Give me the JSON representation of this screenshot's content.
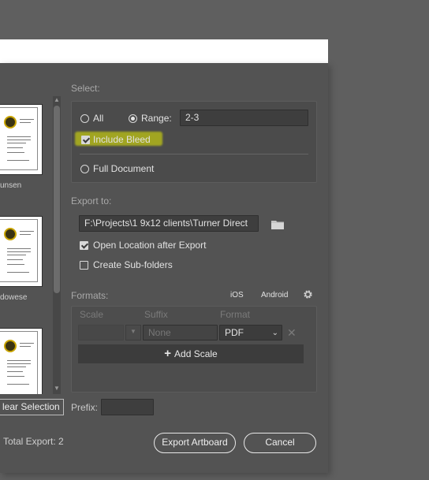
{
  "select": {
    "heading": "Select:",
    "all_label": "All",
    "range_label": "Range:",
    "range_value": "2-3",
    "include_bleed_label": "Include Bleed",
    "full_document_label": "Full Document",
    "selected_option": "Range",
    "include_bleed_checked": true
  },
  "export_to": {
    "heading": "Export to:",
    "path": "F:\\Projects\\1 9x12 clients\\Turner Direct",
    "open_location_label": "Open Location after Export",
    "open_location_checked": true,
    "sub_folders_label": "Create Sub-folders",
    "sub_folders_checked": false
  },
  "formats": {
    "heading": "Formats:",
    "ios_label": "iOS",
    "android_label": "Android",
    "col_scale": "Scale",
    "col_suffix": "Suffix",
    "col_format": "Format",
    "suffix_placeholder": "None",
    "format_value": "PDF",
    "add_scale_label": "Add Scale"
  },
  "artboards": {
    "items": [
      {
        "name": "unsen"
      },
      {
        "name": "dowese"
      },
      {
        "name": ""
      }
    ]
  },
  "footer": {
    "clear_selection_label": "lear Selection",
    "prefix_label": "Prefix:",
    "prefix_value": "",
    "total_export": "Total Export: 2",
    "export_button": "Export Artboard",
    "cancel_button": "Cancel"
  },
  "colors": {
    "dialog_bg": "#535353",
    "highlight": "#e8f000"
  }
}
